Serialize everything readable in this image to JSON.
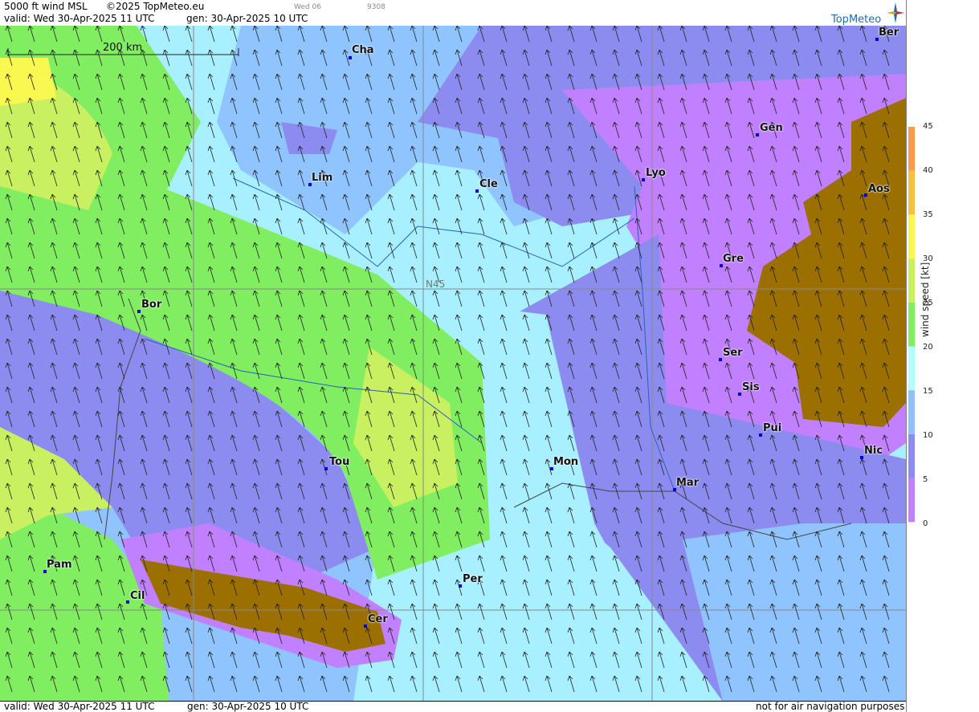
{
  "header": {
    "product": "5000 ft wind MSL",
    "copyright": "©2025 TopMeteo.eu",
    "valid_label": "valid:  Wed  30-Apr-2025  11 UTC",
    "gen_label": "gen: 30-Apr-2025 10 UTC",
    "run_tag": "Wed 06",
    "code": "9308",
    "brand": "TopMeteo"
  },
  "map": {
    "scale_label": "200 km",
    "lat_label": "N45",
    "cities": [
      {
        "name": "Cha"
      },
      {
        "name": "Ber"
      },
      {
        "name": "Gen"
      },
      {
        "name": "Lim"
      },
      {
        "name": "Cle"
      },
      {
        "name": "Lyo"
      },
      {
        "name": "Aos"
      },
      {
        "name": "Gre"
      },
      {
        "name": "Bor"
      },
      {
        "name": "Ser"
      },
      {
        "name": "Sis"
      },
      {
        "name": "Pui"
      },
      {
        "name": "Tou"
      },
      {
        "name": "Mon"
      },
      {
        "name": "Nic"
      },
      {
        "name": "Mar"
      },
      {
        "name": "Pam"
      },
      {
        "name": "Cil"
      },
      {
        "name": "Per"
      },
      {
        "name": "Cer"
      }
    ]
  },
  "legend": {
    "title": "wind speed [kt]",
    "ticks": [
      "45",
      "40",
      "35",
      "30",
      "25",
      "20",
      "15",
      "10",
      "5",
      "0"
    ],
    "colors": [
      "#f07060",
      "#f89a50",
      "#f8c040",
      "#f8f850",
      "#c8f060",
      "#80ee60",
      "#b0ffff",
      "#90c0ff",
      "#8c8cf0",
      "#c080ff",
      "#9c7000"
    ]
  },
  "footer": {
    "valid_label": "valid:  Wed  30-Apr-2025  11 UTC",
    "gen_label": "gen: 30-Apr-2025 10 UTC",
    "disclaimer": "not for air navigation purposes"
  }
}
